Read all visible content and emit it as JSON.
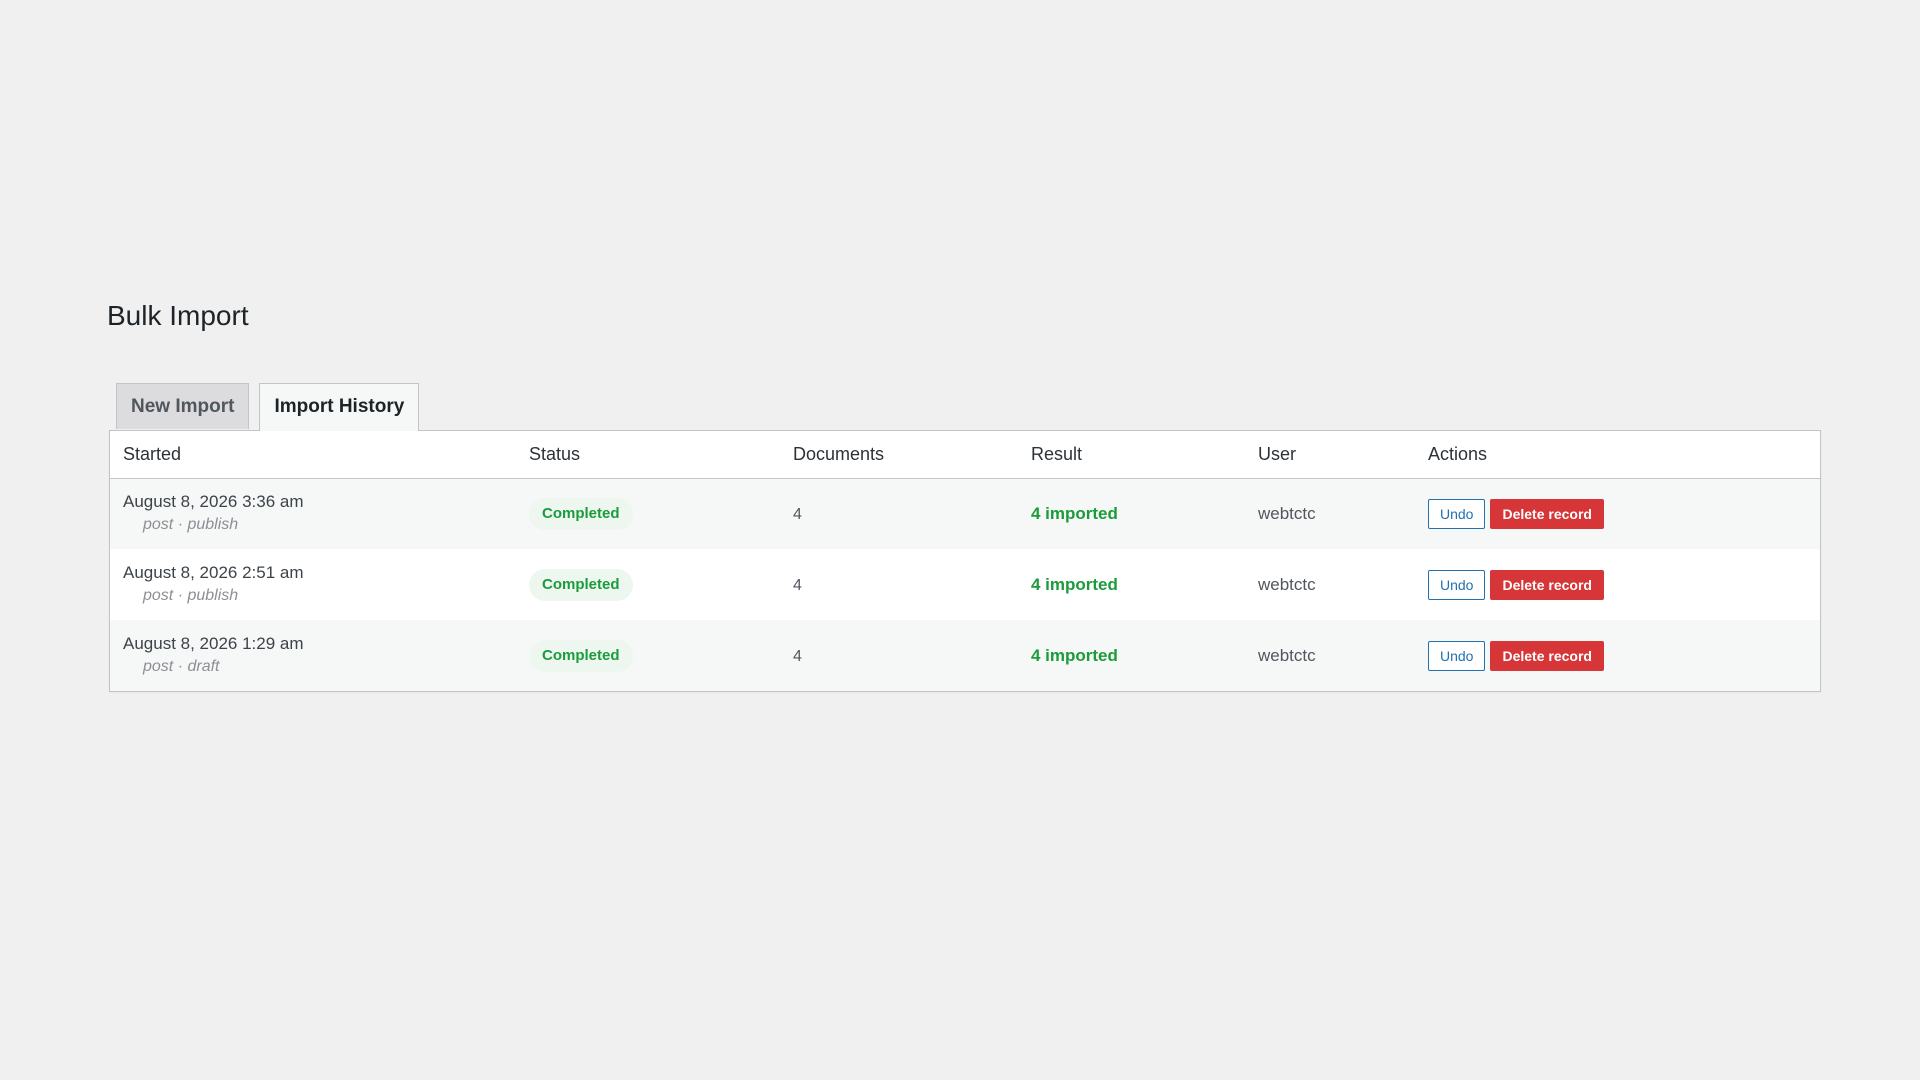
{
  "page": {
    "title": "Bulk Import"
  },
  "tabs": [
    {
      "label": "New Import",
      "active": false
    },
    {
      "label": "Import History",
      "active": true
    }
  ],
  "table": {
    "columns": [
      "Started",
      "Status",
      "Documents",
      "Result",
      "User",
      "Actions"
    ],
    "rows": [
      {
        "started": "August 8, 2026 3:36 am",
        "meta": "post · publish",
        "status": "Completed",
        "documents": "4",
        "result": "4 imported",
        "user": "webtctc",
        "undo_label": "Undo",
        "delete_label": "Delete record"
      },
      {
        "started": "August 8, 2026 2:51 am",
        "meta": "post · publish",
        "status": "Completed",
        "documents": "4",
        "result": "4 imported",
        "user": "webtctc",
        "undo_label": "Undo",
        "delete_label": "Delete record"
      },
      {
        "started": "August 8, 2026 1:29 am",
        "meta": "post · draft",
        "status": "Completed",
        "documents": "4",
        "result": "4 imported",
        "user": "webtctc",
        "undo_label": "Undo",
        "delete_label": "Delete record"
      }
    ]
  },
  "colors": {
    "background": "#f0f0f1",
    "success": "#1a9c3a",
    "undo_border": "#2271b1",
    "delete_bg": "#d63638"
  }
}
